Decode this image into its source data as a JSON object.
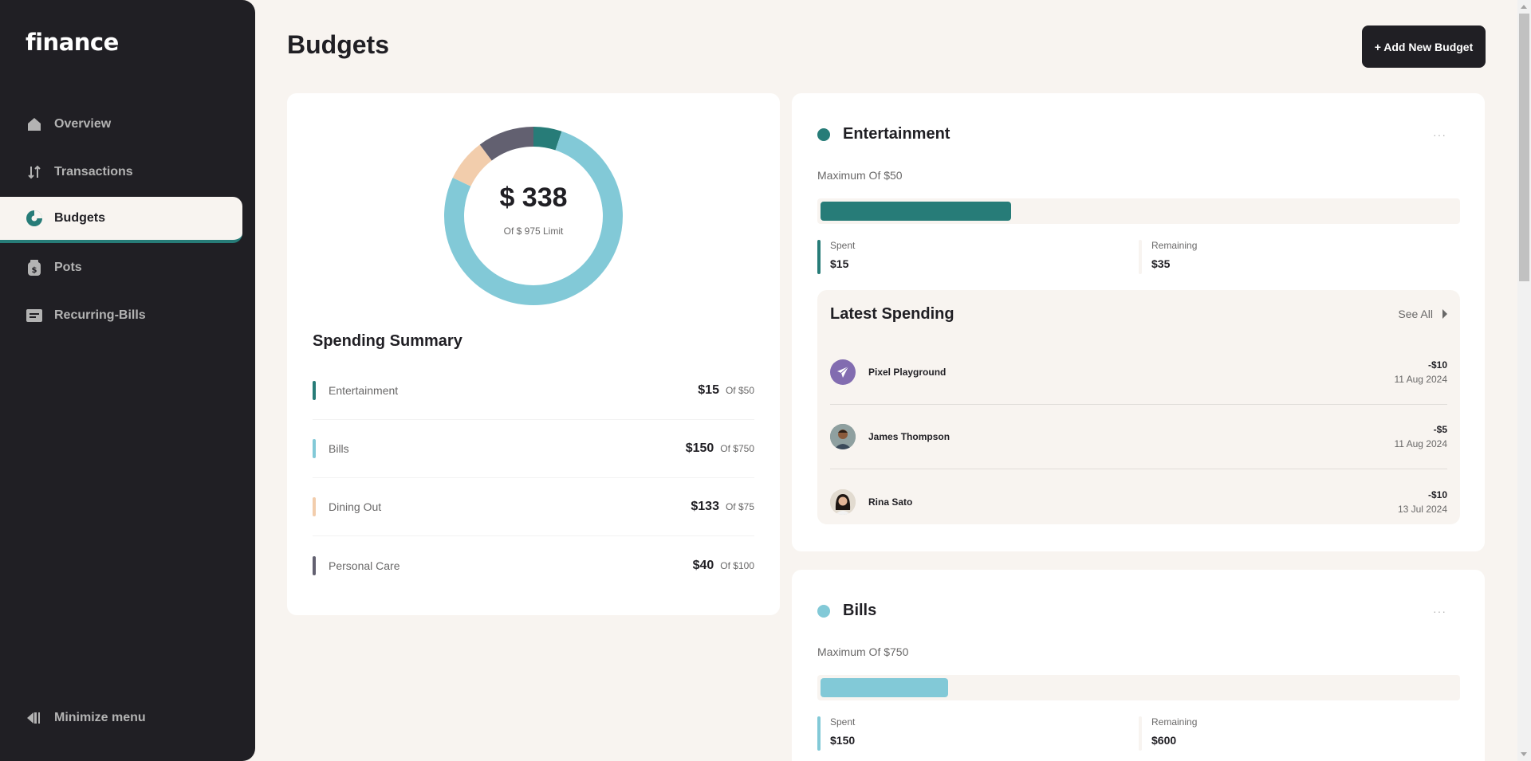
{
  "app": {
    "logo": "finance"
  },
  "nav": {
    "items": [
      {
        "label": "Overview",
        "icon": "home-icon"
      },
      {
        "label": "Transactions",
        "icon": "arrows-updown-icon"
      },
      {
        "label": "Budgets",
        "icon": "pie-chart-icon",
        "active": true
      },
      {
        "label": "Pots",
        "icon": "jar-icon"
      },
      {
        "label": "Recurring-Bills",
        "icon": "receipt-icon"
      }
    ],
    "minimize_label": "Minimize menu"
  },
  "header": {
    "title": "Budgets",
    "add_button": "+ Add New Budget"
  },
  "summary": {
    "total": "$ 338",
    "limit": "Of $ 975 Limit",
    "title": "Spending Summary",
    "rows": [
      {
        "name": "Entertainment",
        "spent": "$15",
        "max": "Of $50",
        "color": "#277c78"
      },
      {
        "name": "Bills",
        "spent": "$150",
        "max": "Of $750",
        "color": "#82c9d7"
      },
      {
        "name": "Dining Out",
        "spent": "$133",
        "max": "Of $75",
        "color": "#f2cdac"
      },
      {
        "name": "Personal Care",
        "spent": "$40",
        "max": "Of $100",
        "color": "#626070"
      }
    ]
  },
  "chart_data": {
    "type": "pie",
    "categories": [
      "Entertainment",
      "Bills",
      "Dining Out",
      "Personal Care"
    ],
    "values": [
      50,
      750,
      75,
      100
    ],
    "colors": [
      "#277c78",
      "#82c9d7",
      "#f2cdac",
      "#626070"
    ]
  },
  "budgets": [
    {
      "name": "Entertainment",
      "color": "#277c78",
      "max": "Maximum Of $50",
      "progress": 0.3,
      "spent_label": "Spent",
      "spent": "$15",
      "remaining_label": "Remaining",
      "remaining": "$35",
      "menu": "···",
      "latest": {
        "title": "Latest Spending",
        "see_all": "See All",
        "transactions": [
          {
            "name": "Pixel Playground",
            "amount": "-$10",
            "date": "11 Aug 2024",
            "avatar": "paper-plane-icon"
          },
          {
            "name": "James Thompson",
            "amount": "-$5",
            "date": "11 Aug 2024",
            "avatar": "person-photo"
          },
          {
            "name": "Rina Sato",
            "amount": "-$10",
            "date": "13 Jul 2024",
            "avatar": "person-photo"
          }
        ]
      }
    },
    {
      "name": "Bills",
      "color": "#82c9d7",
      "max": "Maximum Of $750",
      "progress": 0.2,
      "spent_label": "Spent",
      "spent": "$150",
      "remaining_label": "Remaining",
      "remaining": "$600",
      "menu": "···"
    }
  ]
}
